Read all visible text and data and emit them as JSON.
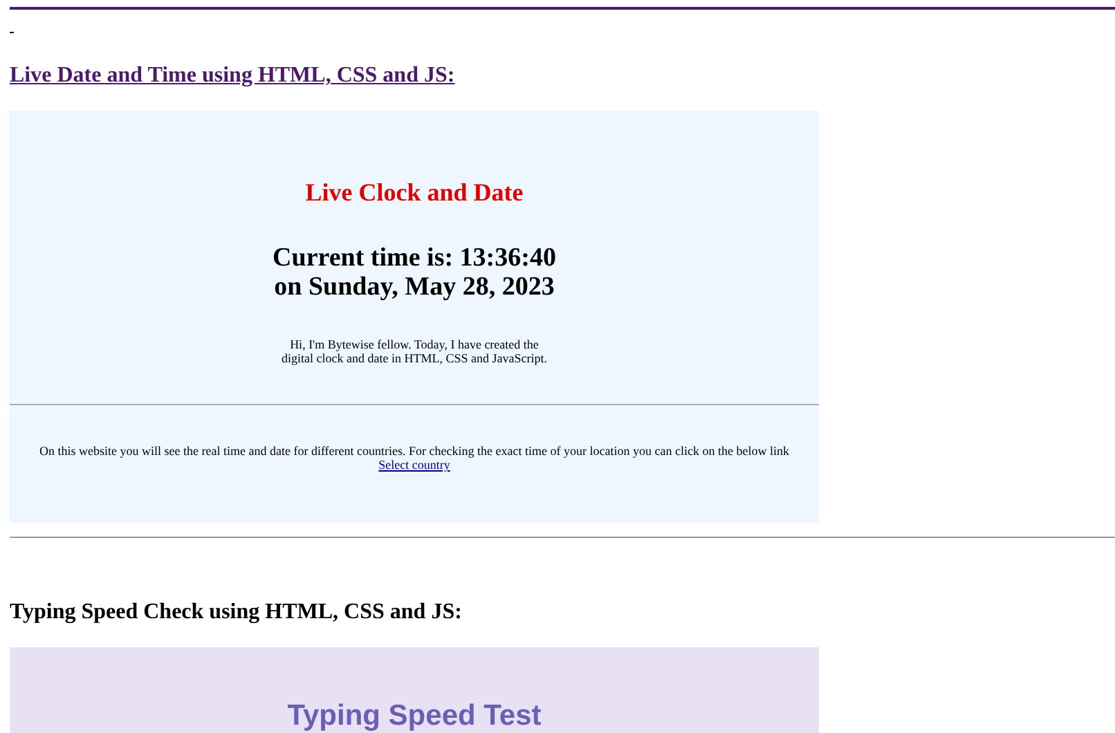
{
  "sections": [
    {
      "heading": "Live Date and Time using HTML, CSS and JS:",
      "heading_link": true,
      "kind": "clock",
      "title": "Live Clock and Date",
      "time_line": "Current time is: 13:36:40",
      "date_line": "on Sunday, May 28, 2023",
      "intro": "Hi, I'm Bytewise fellow. Today, I have created the digital clock and date in HTML, CSS and JavaScript.",
      "info": "On this website you will see the real time and date for different countries. For checking the exact time of your location you can click on the below link",
      "link": "Select country"
    },
    {
      "heading": "Typing Speed Check using HTML, CSS and JS:",
      "heading_link": false,
      "kind": "typing",
      "title": "Typing Speed Test"
    }
  ]
}
